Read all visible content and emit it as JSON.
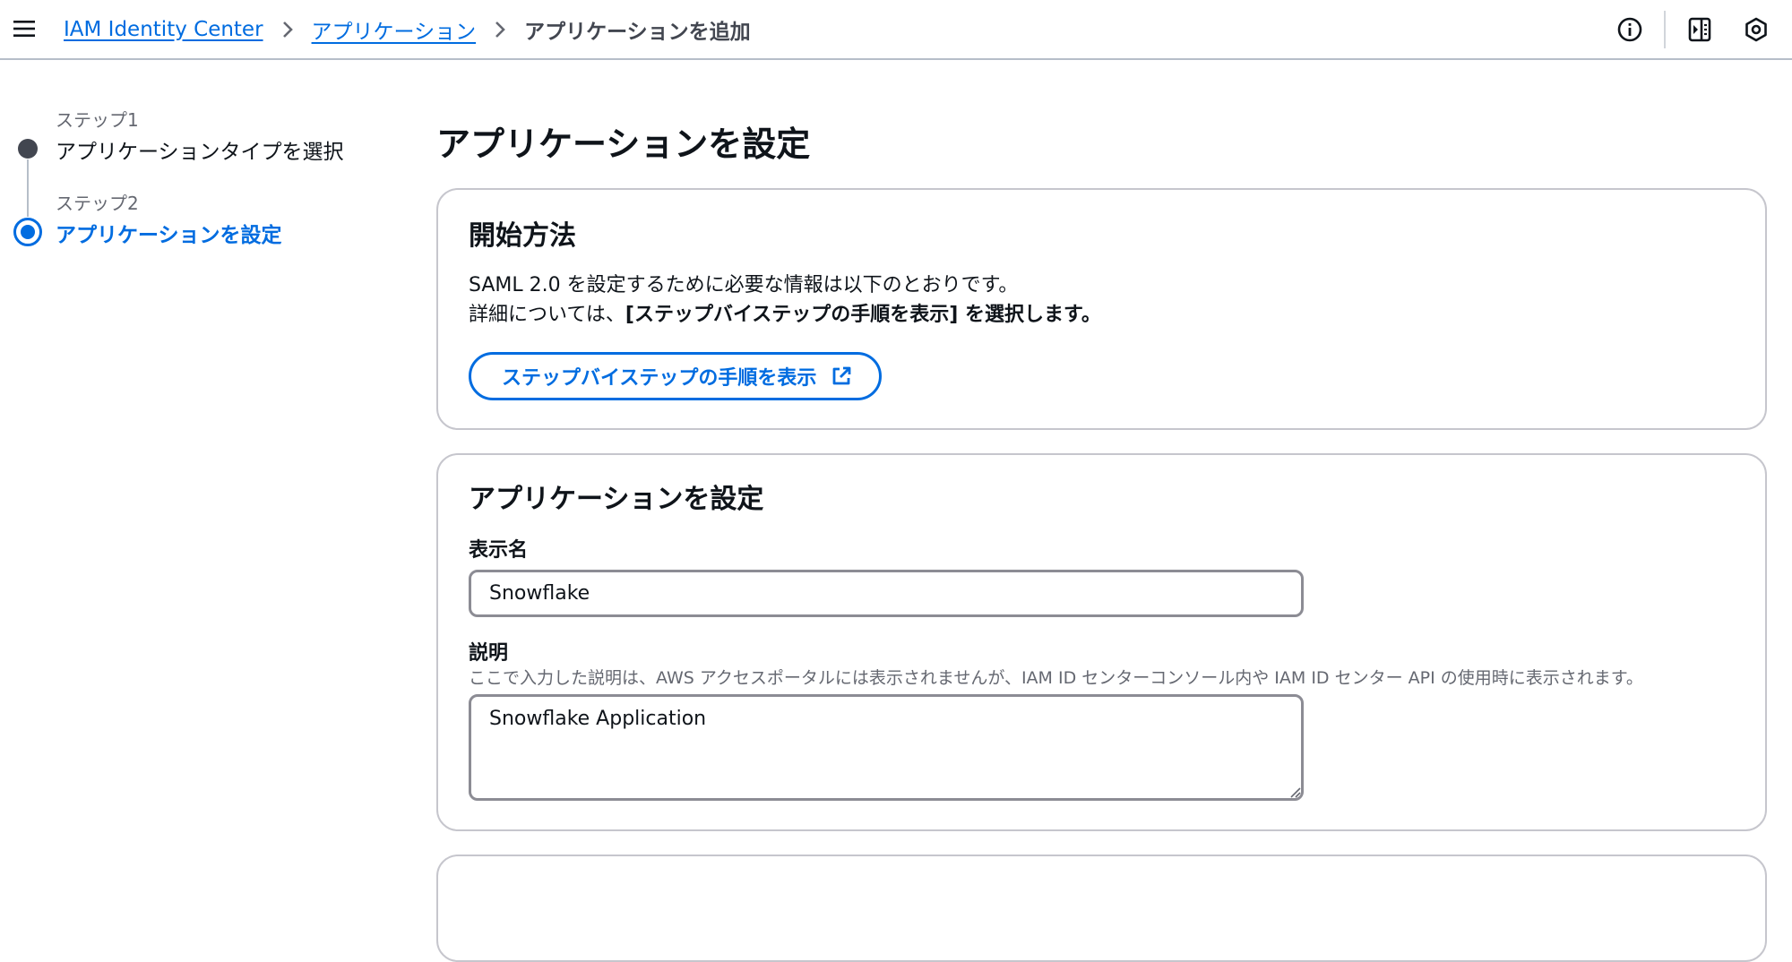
{
  "topbar": {
    "menu_icon": "hamburger-menu-icon",
    "breadcrumbs": [
      {
        "label": "IAM Identity Center",
        "link": true
      },
      {
        "label": "アプリケーション",
        "link": true
      },
      {
        "label": "アプリケーションを追加",
        "link": false
      }
    ],
    "icons": [
      "info-icon",
      "notifications-panel-icon",
      "settings-hexagon-icon"
    ]
  },
  "steps": [
    {
      "caption": "ステップ1",
      "title": "アプリケーションタイプを選択",
      "state": "completed"
    },
    {
      "caption": "ステップ2",
      "title": "アプリケーションを設定",
      "state": "active"
    }
  ],
  "main": {
    "page_title": "アプリケーションを設定",
    "getting_started": {
      "title": "開始方法",
      "line1": "SAML 2.0 を設定するために必要な情報は以下のとおりです。",
      "line2_prefix": "詳細については、",
      "line2_bold": "[ステップバイステップの手順を表示] を選択します。",
      "button_label": "ステップバイステップの手順を表示",
      "button_icon": "external-link-icon"
    },
    "configure": {
      "title": "アプリケーションを設定",
      "display_name_label": "表示名",
      "display_name_value": "Snowflake",
      "description_label": "説明",
      "description_hint": "ここで入力した説明は、AWS アクセスポータルには表示されませんが、IAM ID センターコンソール内や IAM ID センター API の使用時に表示されます。",
      "description_value": "Snowflake Application"
    }
  },
  "colors": {
    "accent": "#006ce0",
    "border": "#c6c6cd",
    "input_border": "#8c8c94",
    "text": "#0f141a",
    "muted": "#656871"
  }
}
